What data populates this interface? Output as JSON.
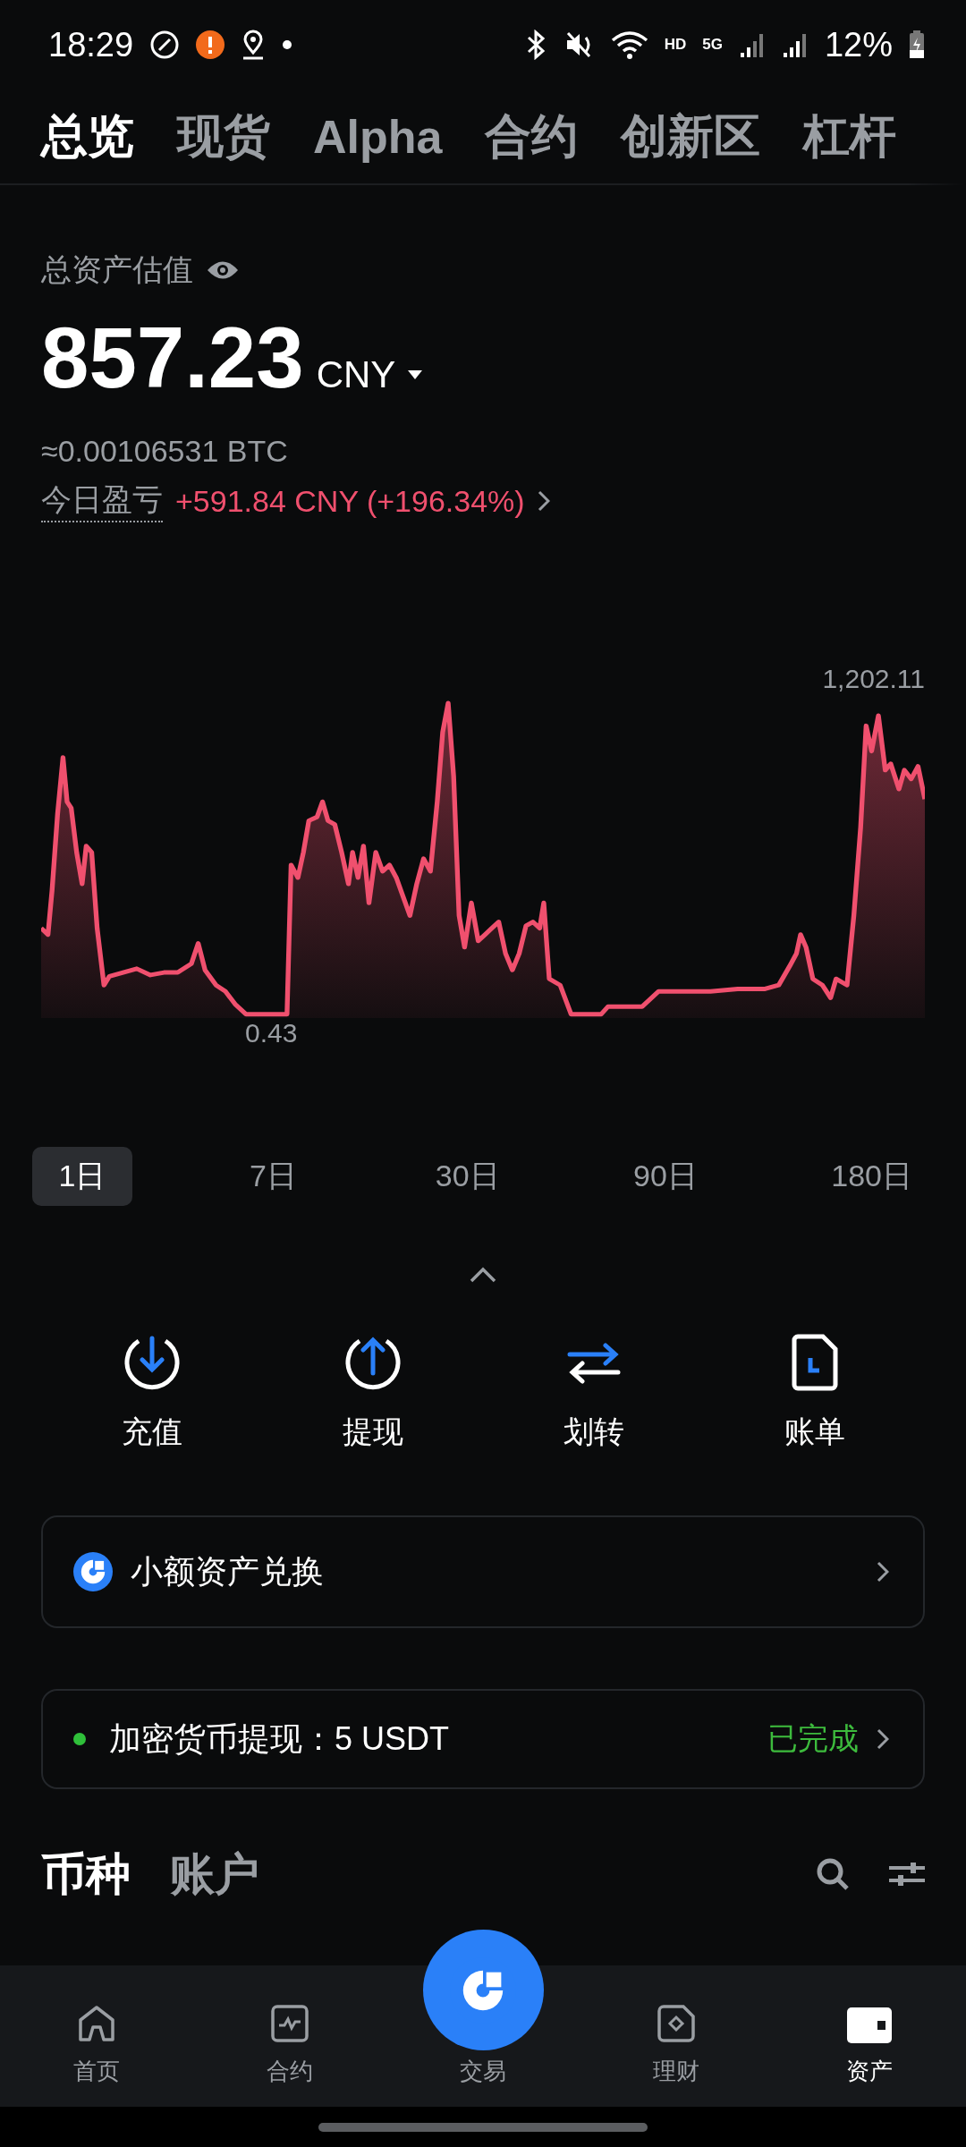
{
  "status_bar": {
    "time": "18:29",
    "hd": "HD",
    "network": "5G",
    "battery": "12%"
  },
  "tabs": [
    {
      "label": "总览",
      "selected": true
    },
    {
      "label": "现货",
      "selected": false
    },
    {
      "label": "Alpha",
      "selected": false
    },
    {
      "label": "合约",
      "selected": false
    },
    {
      "label": "创新区",
      "selected": false
    },
    {
      "label": "杠杆",
      "selected": false
    }
  ],
  "summary": {
    "label": "总资产估值",
    "amount": "857.23",
    "currency": "CNY",
    "btc": "≈0.00106531 BTC",
    "pnl_label": "今日盈亏",
    "pnl_value": "+591.84 CNY (+196.34%)"
  },
  "chart": {
    "max_label": "1,202.11",
    "min_label": "0.43"
  },
  "ranges": [
    {
      "label": "1日",
      "selected": true
    },
    {
      "label": "7日",
      "selected": false
    },
    {
      "label": "30日",
      "selected": false
    },
    {
      "label": "90日",
      "selected": false
    },
    {
      "label": "180日",
      "selected": false
    }
  ],
  "actions": [
    {
      "kind": "deposit",
      "label": "充值"
    },
    {
      "kind": "withdraw",
      "label": "提现"
    },
    {
      "kind": "transfer",
      "label": "划转"
    },
    {
      "kind": "bill",
      "label": "账单"
    }
  ],
  "convert_card": {
    "label": "小额资产兑换"
  },
  "notice": {
    "text": "加密货币提现：5 USDT",
    "status": "已完成"
  },
  "section_tabs": [
    {
      "label": "币种",
      "selected": true
    },
    {
      "label": "账户",
      "selected": false
    }
  ],
  "bottom_nav": [
    {
      "kind": "home",
      "label": "首页",
      "selected": false
    },
    {
      "kind": "futures",
      "label": "合约",
      "selected": false
    },
    {
      "kind": "trade",
      "label": "交易",
      "selected": false
    },
    {
      "kind": "finance",
      "label": "理财",
      "selected": false
    },
    {
      "kind": "assets",
      "label": "资产",
      "selected": true
    }
  ]
}
